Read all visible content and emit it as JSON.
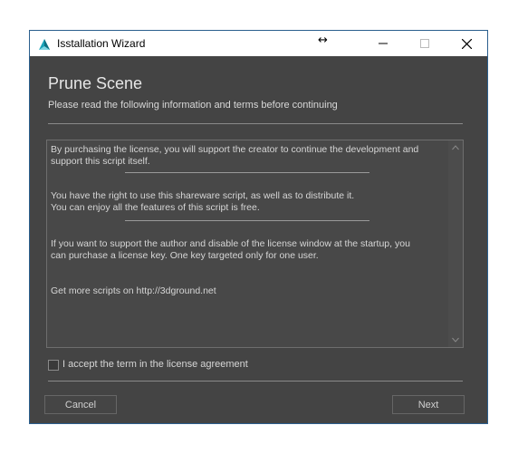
{
  "window": {
    "title": "Isstallation Wizard",
    "resize_cursor": "↔"
  },
  "page": {
    "heading": "Prune Scene",
    "subheading": "Please read the following information and terms before continuing"
  },
  "license": {
    "lines": [
      "By purchasing the license, you will support the creator  to continue the development and",
      "support this script itself.",
      "You have the right to use this shareware script, as well as to distribute it.",
      "You can enjoy all the features of this script is free.",
      "If you want to support the author and disable of the license window at the startup, you",
      "can purchase a license key. One key targeted only for one user.",
      "Get more scripts on http://3dground.net"
    ]
  },
  "agreement": {
    "checkbox_label": "I accept the term in the license agreement",
    "checked": false
  },
  "buttons": {
    "cancel": "Cancel",
    "next": "Next"
  },
  "colors": {
    "background": "#444444",
    "titlebar": "#ffffff",
    "border": "#2b5f8e",
    "text": "#d6d6d6"
  },
  "icons": [
    "app-3d-icon",
    "minimize-icon",
    "maximize-icon",
    "close-icon",
    "scroll-up-icon",
    "scroll-down-icon"
  ]
}
